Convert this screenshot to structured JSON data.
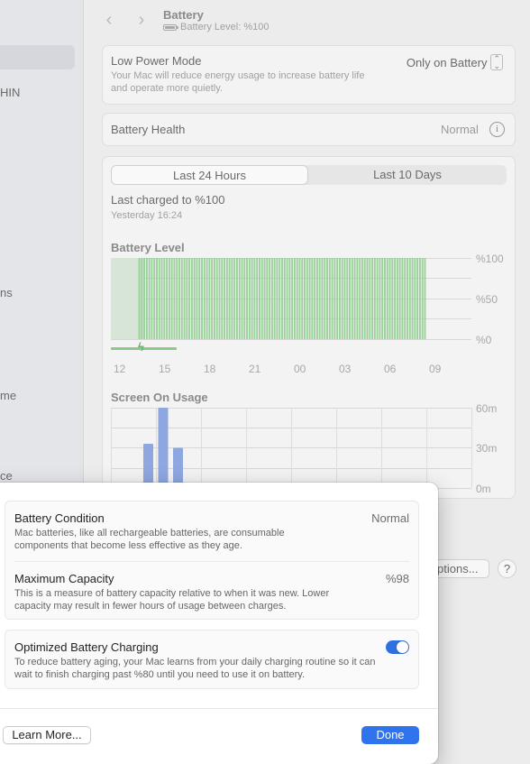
{
  "sidebar": {
    "fragments": [
      "HIN",
      "ns",
      "me",
      "ce"
    ]
  },
  "header": {
    "back_icon": "chevron-left-icon",
    "forward_icon": "chevron-right-icon",
    "title": "Battery",
    "subtitle": "Battery Level: %100"
  },
  "low_power": {
    "label": "Low Power Mode",
    "description": "Your Mac will reduce energy usage to increase battery life and operate more quietly.",
    "value": "Only on Battery"
  },
  "battery_health": {
    "label": "Battery Health",
    "value": "Normal"
  },
  "segmented": {
    "options": [
      "Last 24 Hours",
      "Last 10 Days"
    ],
    "selected": "Last 24 Hours"
  },
  "last_charged": {
    "label": "Last charged to %100",
    "time": "Yesterday 16:24"
  },
  "battery_level_chart": {
    "title": "Battery Level",
    "x_labels": [
      "12",
      "15",
      "18",
      "21",
      "00",
      "03",
      "06",
      "09"
    ],
    "y_labels": [
      "%100",
      "%50",
      "%0"
    ],
    "bar_color": "#9bd19b"
  },
  "screen_usage_chart": {
    "title": "Screen On Usage",
    "y_labels": [
      "60m",
      "30m",
      "0m"
    ],
    "bar_color": "#8ea7e0"
  },
  "chart_data": [
    {
      "type": "bar",
      "title": "Battery Level",
      "x_tick_labels": [
        "12",
        "15",
        "18",
        "21",
        "00",
        "03",
        "06",
        "09"
      ],
      "y_tick_labels": [
        "%100",
        "%50",
        "%0"
      ],
      "ylim": [
        0,
        100
      ],
      "series": [
        {
          "values": [
            0,
            0,
            0,
            0,
            0,
            0,
            0,
            0,
            0,
            0,
            0,
            100,
            100,
            100,
            100,
            100,
            100,
            100,
            100,
            100,
            100,
            100,
            100,
            100,
            100,
            100,
            100,
            100,
            100,
            100,
            100,
            100,
            100,
            100,
            100,
            100,
            100,
            100,
            100,
            100,
            100,
            100,
            100,
            100,
            100,
            100,
            100,
            100,
            100,
            100,
            100,
            100,
            100,
            100,
            100,
            100,
            100,
            100,
            100,
            100,
            100,
            100,
            100,
            100,
            100,
            100,
            100,
            100,
            100,
            100,
            100,
            100,
            100,
            100,
            100,
            100,
            100,
            100,
            100,
            100,
            100,
            100,
            100,
            100,
            100,
            100,
            100,
            100,
            100,
            100,
            100,
            100,
            100,
            100,
            100,
            100,
            100,
            100,
            100,
            100,
            100,
            100,
            100,
            100,
            100,
            100,
            100,
            100,
            100,
            100,
            100,
            100,
            100,
            100,
            100,
            100,
            100,
            100,
            100,
            100,
            100,
            100,
            100,
            100,
            100,
            100
          ]
        }
      ],
      "charging_indicator": "lightning-icon"
    },
    {
      "type": "bar",
      "title": "Screen On Usage",
      "y_tick_labels": [
        "60m",
        "30m",
        "0m"
      ],
      "ylim": [
        0,
        60
      ],
      "series": [
        {
          "values": [
            0,
            33,
            60,
            30,
            0,
            0,
            0,
            0,
            0,
            0,
            0,
            0,
            0,
            0,
            0,
            0,
            0,
            0,
            0,
            0,
            0,
            0,
            0,
            0
          ]
        }
      ]
    }
  ],
  "bg_buttons": {
    "options_label": "ptions...",
    "help_label": "?"
  },
  "sheet": {
    "battery_condition": {
      "title": "Battery Condition",
      "value": "Normal",
      "description": "Mac batteries, like all rechargeable batteries, are consumable components that become less effective as they age."
    },
    "maximum_capacity": {
      "title": "Maximum Capacity",
      "value": "%98",
      "description": "This is a measure of battery capacity relative to when it was new. Lower capacity may result in fewer hours of usage between charges."
    },
    "optimized_charging": {
      "title": "Optimized Battery Charging",
      "enabled": true,
      "description": "To reduce battery aging, your Mac learns from your daily charging routine so it can wait to finish charging past %80 until you need to use it on battery."
    },
    "learn_more_label": "Learn More...",
    "done_label": "Done",
    "accent_color": "#2f74ec"
  }
}
